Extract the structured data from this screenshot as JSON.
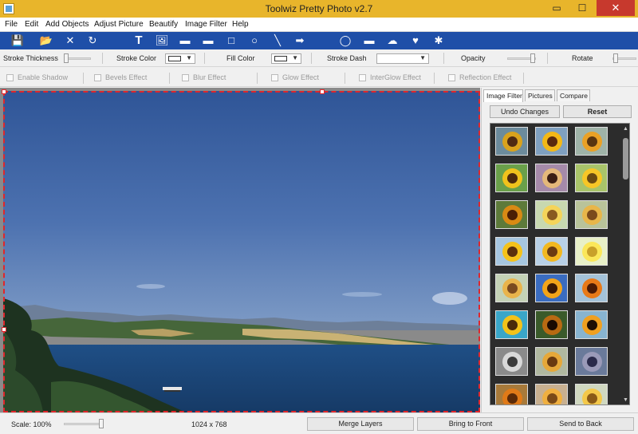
{
  "window": {
    "title": "Toolwiz Pretty Photo v2.7",
    "minimize_glyph": "▭",
    "maximize_glyph": "☐",
    "close_glyph": "✕"
  },
  "menu": [
    "File",
    "Edit",
    "Add Objects",
    "Adjust Picture",
    "Beautify",
    "Image Filter",
    "Help"
  ],
  "toolbar": {
    "icons": [
      "save-icon",
      "open-folder-icon",
      "delete-icon",
      "rotate-icon",
      "text-icon",
      "image-icon",
      "rectangle-filled-icon",
      "rounded-rect-icon",
      "rectangle-outline-icon",
      "ellipse-icon",
      "line-icon",
      "arrow-icon",
      "speech-bubble-icon",
      "callout-icon",
      "thought-cloud-icon",
      "heart-bubble-icon",
      "star-burst-icon"
    ],
    "glyphs": [
      "💾",
      "📂",
      "✕",
      "↻",
      "T",
      "🖼",
      "▬",
      "▬",
      "□",
      "○",
      "╲",
      "➡",
      "◯",
      "▬",
      "☁",
      "♥",
      "✱"
    ]
  },
  "props": {
    "stroke_thickness_label": "Stroke Thickness",
    "stroke_color_label": "Stroke Color",
    "fill_color_label": "Fill Color",
    "stroke_dash_label": "Stroke Dash",
    "opacity_label": "Opacity",
    "rotate_label": "Rotate"
  },
  "effects": {
    "enable_shadow": "Enable Shadow",
    "bevels": "Bevels Effect",
    "blur": "Blur Effect",
    "glow": "Glow Effect",
    "interglow": "InterGlow Effect",
    "reflection": "Reflection Effect"
  },
  "side_panel": {
    "tabs": [
      "Image Filter",
      "Pictures",
      "Compare"
    ],
    "undo_label": "Undo Changes",
    "reset_label": "Reset"
  },
  "status": {
    "scale_label": "Scale: 100%",
    "dimensions": "1024 x 768",
    "merge_label": "Merge Layers",
    "front_label": "Bring to Front",
    "back_label": "Send to Back"
  },
  "colors": {
    "title_bar": "#e8b52b",
    "toolbar": "#1f4fa8",
    "selection": "#e0262b"
  }
}
